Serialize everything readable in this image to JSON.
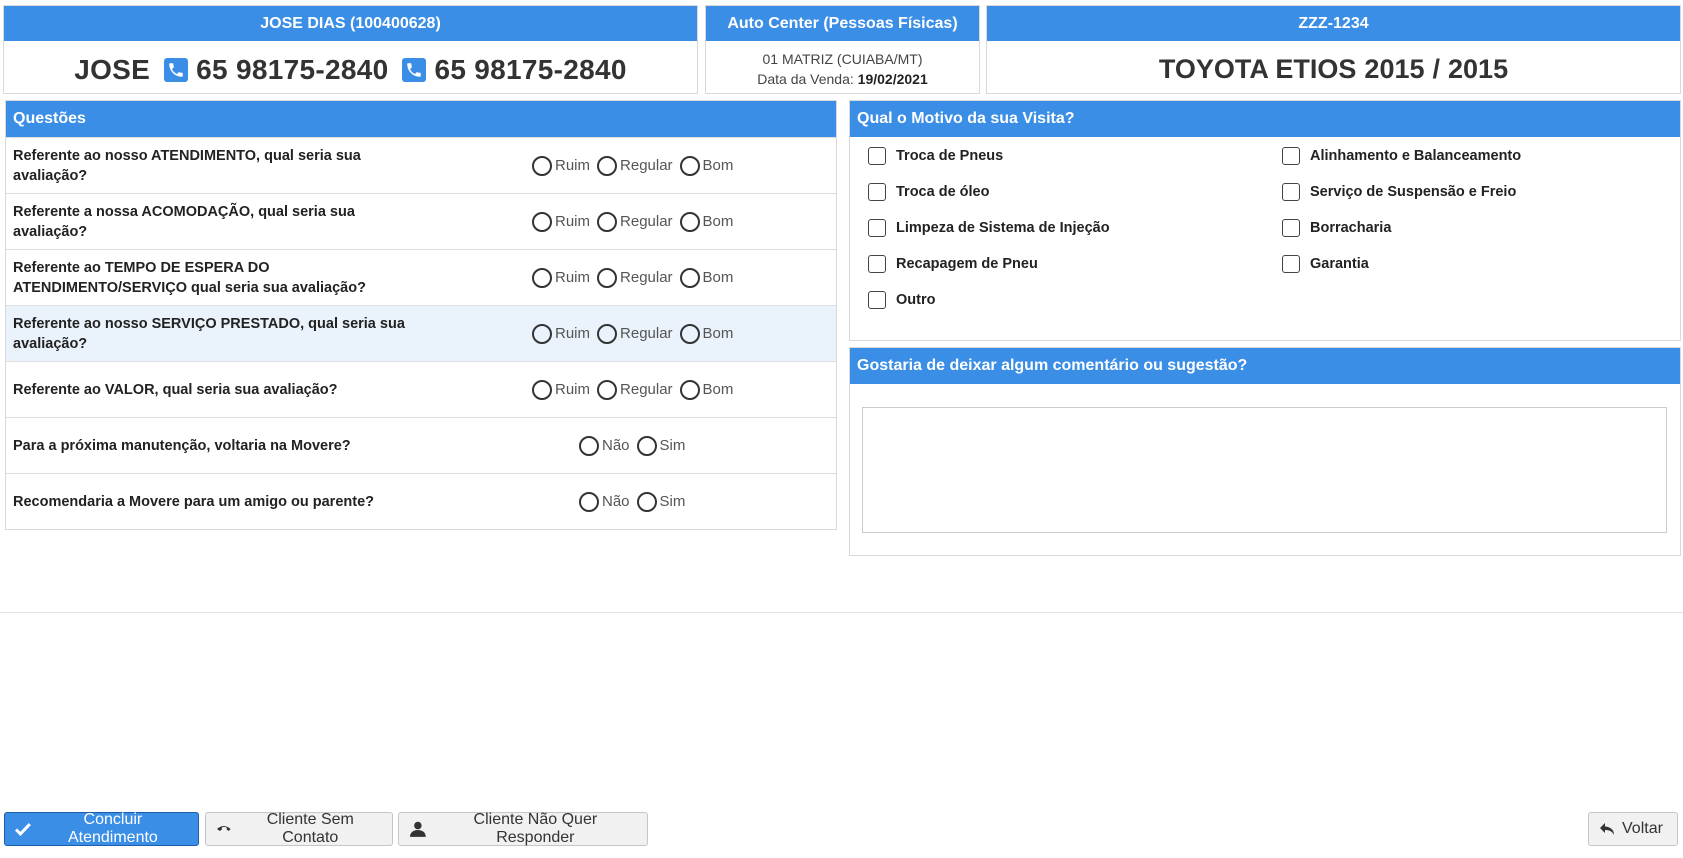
{
  "customer": {
    "header": "JOSE DIAS (100400628)",
    "name": "JOSE",
    "phone1": "65 98175-2840",
    "phone2": "65 98175-2840"
  },
  "store": {
    "header": "Auto Center (Pessoas Físicas)",
    "branch": "01 MATRIZ (CUIABA/MT)",
    "sale_date_label": "Data da Venda:",
    "sale_date": "19/02/2021"
  },
  "vehicle": {
    "plate": "ZZZ-1234",
    "model": "TOYOTA ETIOS",
    "year_fab": "2015",
    "separator": "/",
    "year_model": "2015"
  },
  "questions": {
    "title": "Questões",
    "items": [
      {
        "text": "Referente ao nosso ATENDIMENTO, qual seria sua avaliação?",
        "options": [
          "Ruim",
          "Regular",
          "Bom"
        ]
      },
      {
        "text": "Referente a nossa ACOMODAÇÃO, qual seria sua avaliação?",
        "options": [
          "Ruim",
          "Regular",
          "Bom"
        ]
      },
      {
        "text": "Referente ao TEMPO DE ESPERA DO ATENDIMENTO/SERVIÇO qual seria sua avaliação?",
        "options": [
          "Ruim",
          "Regular",
          "Bom"
        ]
      },
      {
        "text": "Referente ao nosso SERVIÇO PRESTADO, qual seria sua avaliação?",
        "options": [
          "Ruim",
          "Regular",
          "Bom"
        ]
      },
      {
        "text": "Referente ao VALOR, qual seria sua avaliação?",
        "options": [
          "Ruim",
          "Regular",
          "Bom"
        ]
      },
      {
        "text": "Para a próxima manutenção, voltaria na Movere?",
        "options": [
          "Não",
          "Sim"
        ]
      },
      {
        "text": "Recomendaria a Movere para um amigo ou parente?",
        "options": [
          "Não",
          "Sim"
        ]
      }
    ]
  },
  "visit_reason": {
    "title": "Qual o Motivo da sua Visita?",
    "options": [
      "Troca de Pneus",
      "Alinhamento e Balanceamento",
      "Troca de óleo",
      "Serviço de Suspensão e Freio",
      "Limpeza de Sistema de Injeção",
      "Borracharia",
      "Recapagem de Pneu",
      "Garantia",
      "Outro"
    ]
  },
  "comment": {
    "title": "Gostaria de deixar algum comentário ou sugestão?",
    "value": ""
  },
  "actions": {
    "finish": "Concluir Atendimento",
    "no_contact": "Cliente Sem Contato",
    "no_answer": "Cliente Não Quer Responder",
    "back": "Voltar"
  },
  "colors": {
    "accent": "#3a8ee6",
    "highlight_row": "#eaf2fb"
  }
}
